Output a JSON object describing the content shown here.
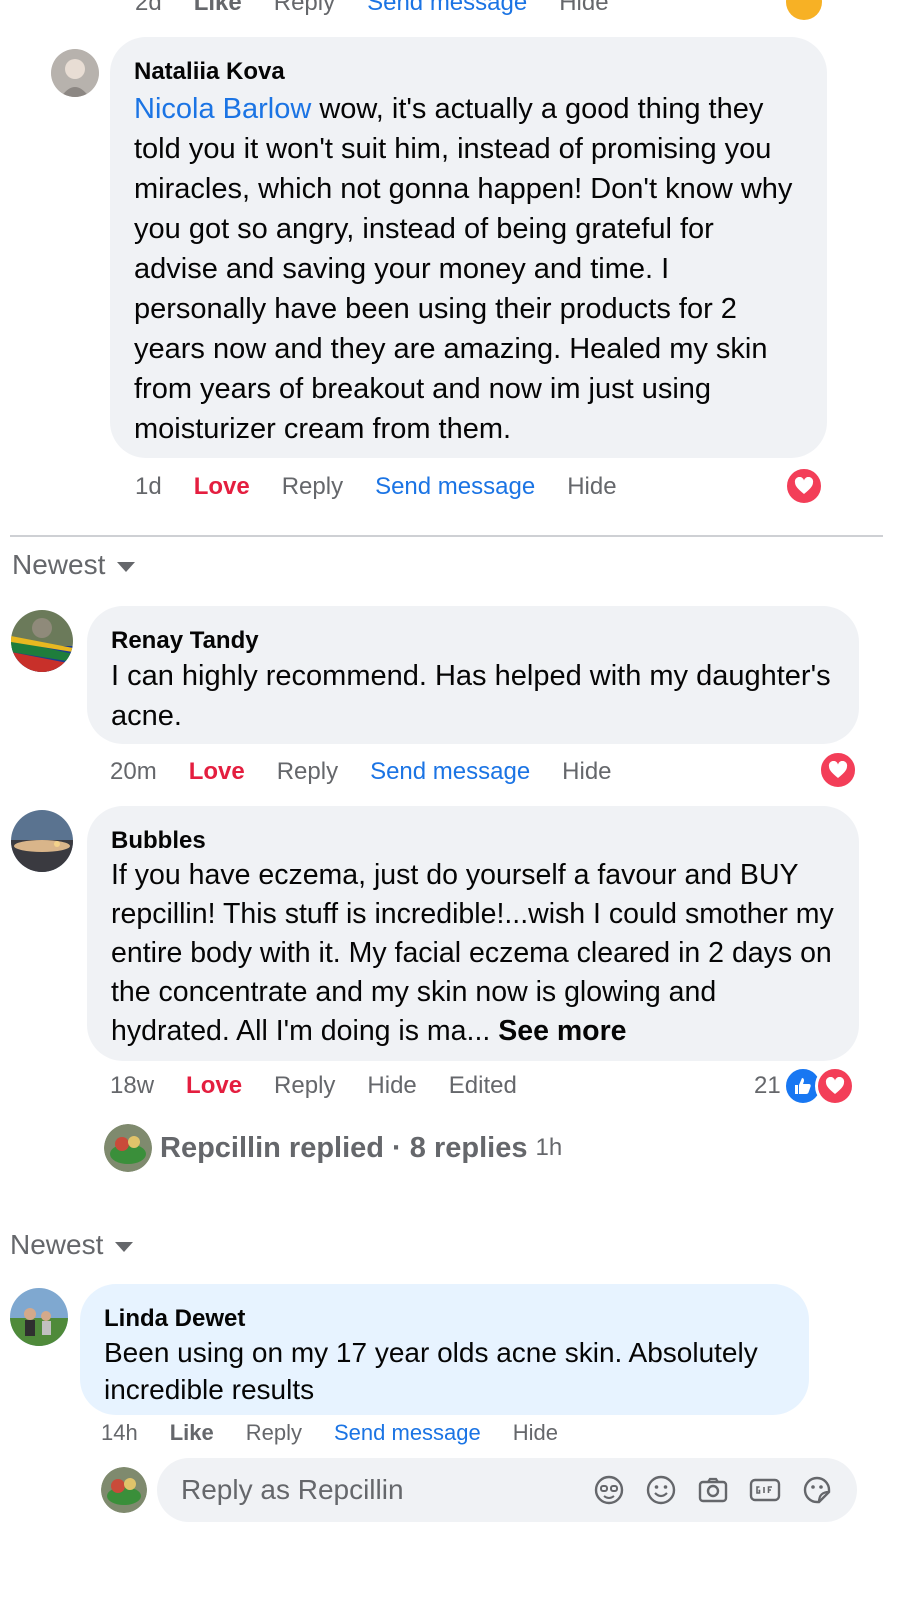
{
  "top_partial": {
    "time": "2d",
    "like": "Like",
    "reply": "Reply",
    "send_message": "Send message",
    "hide": "Hide",
    "reaction_icon": "sad-emoji-icon"
  },
  "nataliia_comment": {
    "author": "Nataliia Kova",
    "mention": "Nicola Barlow",
    "text": " wow, it's actually a good thing they told you it won't suit him, instead of promising you miracles, which not gonna happen! Don't know why you got so angry, instead of being grateful for advise and saving your money and time. I personally have been using their products for 2 years now and they are amazing. Healed my skin from years of breakout and now im just using moisturizer cream from them.",
    "time": "1d",
    "love": "Love",
    "reply": "Reply",
    "send_message": "Send message",
    "hide": "Hide"
  },
  "sort1": {
    "label": "Newest"
  },
  "renay_comment": {
    "author": "Renay Tandy",
    "text": "I can highly recommend. Has helped with my daughter's acne.",
    "time": "20m",
    "love": "Love",
    "reply": "Reply",
    "send_message": "Send message",
    "hide": "Hide"
  },
  "bubbles_comment": {
    "author": "Bubbles",
    "text": "If you have eczema, just do yourself a favour and BUY repcillin! This stuff is incredible!...wish I could smother my entire body with it. My facial eczema cleared in 2 days on the concentrate and my skin now is glowing and hydrated. All I'm doing is ma...",
    "see_more": "See more",
    "time": "18w",
    "love": "Love",
    "reply": "Reply",
    "hide": "Hide",
    "edited": "Edited",
    "reaction_count": "21",
    "replied_text": "Repcillin replied · 8 replies",
    "replied_time": "1h"
  },
  "sort2": {
    "label": "Newest"
  },
  "linda_comment": {
    "author": "Linda Dewet",
    "text": "Been using on my 17 year olds acne skin. Absolutely incredible results",
    "time": "14h",
    "like": "Like",
    "reply": "Reply",
    "send_message": "Send message",
    "hide": "Hide"
  },
  "reply_input": {
    "placeholder": "Reply as Repcillin",
    "icons": [
      "avatar-sticker-icon",
      "emoji-icon",
      "camera-icon",
      "gif-icon",
      "sticker-icon"
    ]
  },
  "colors": {
    "bubble_bg": "#f0f2f5",
    "bubble_highlight_bg": "#e7f3ff",
    "love_red": "#e41e3f",
    "link_blue": "#1b74e4",
    "muted": "#65676b"
  }
}
